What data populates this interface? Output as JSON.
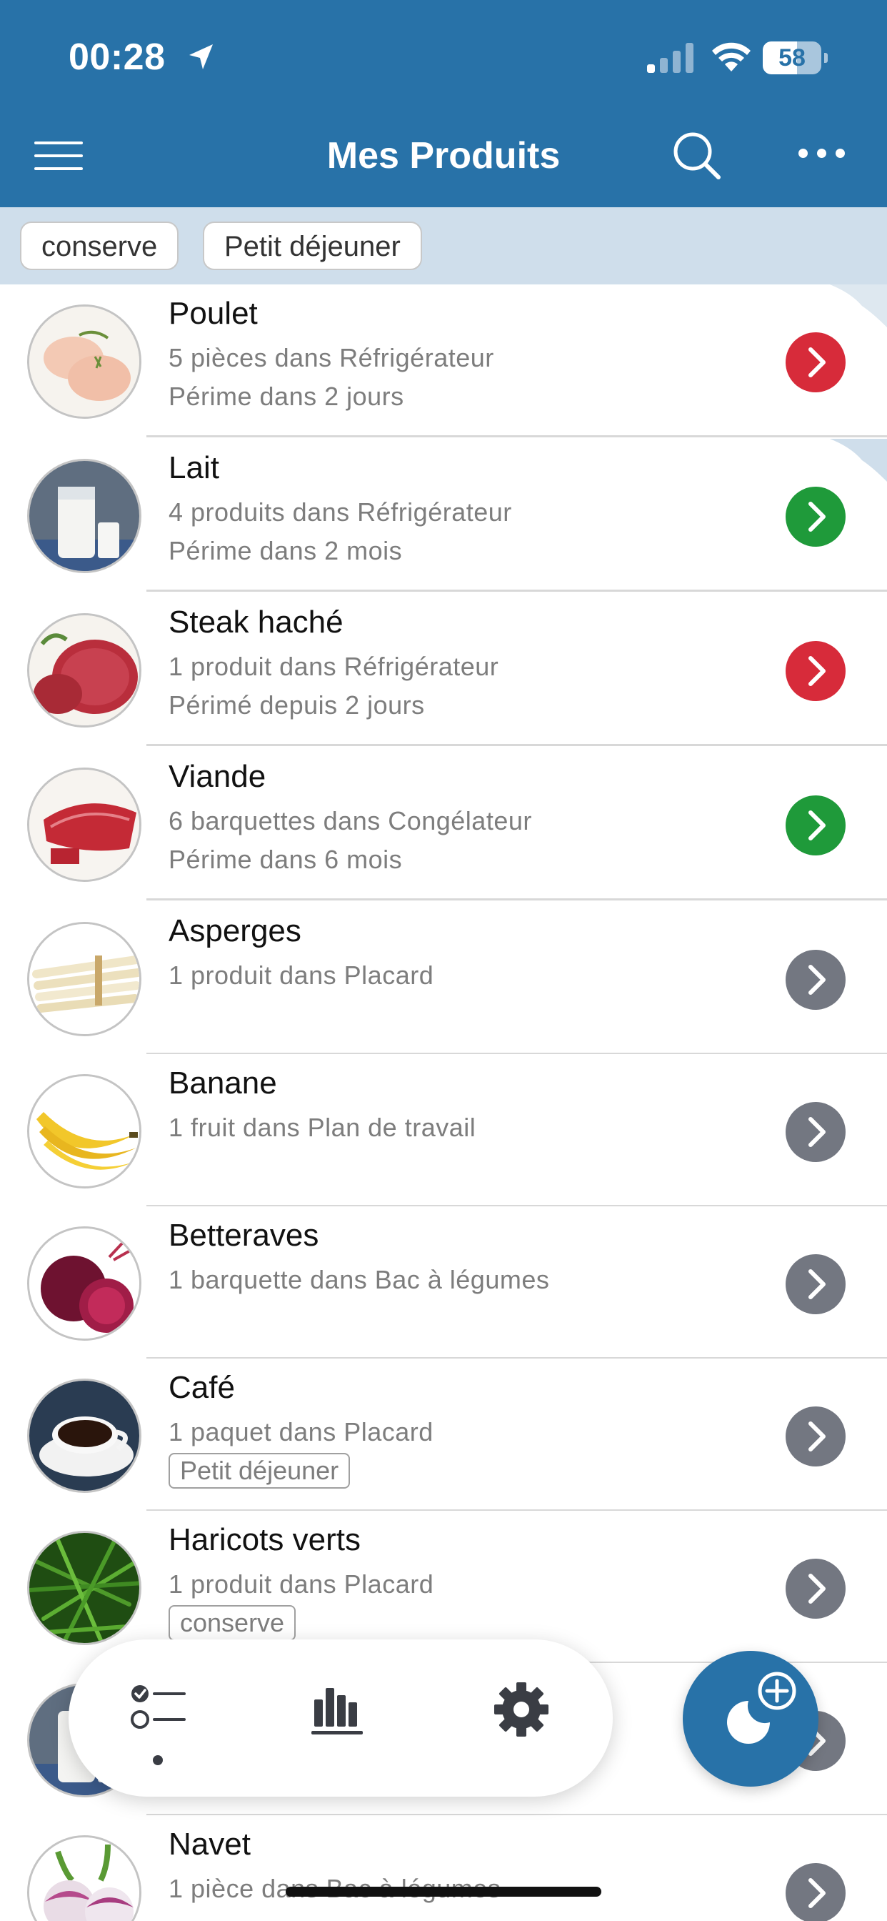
{
  "status_bar": {
    "time": "00:28",
    "battery": "58",
    "battery_level": 0.58
  },
  "header": {
    "title": "Mes Produits"
  },
  "filters": [
    {
      "label": "conserve"
    },
    {
      "label": "Petit déjeuner"
    }
  ],
  "colors": {
    "header_bg": "#2872a8",
    "chip_bar_bg": "#cfdeeb",
    "status_red": "#d72b3a",
    "status_green": "#1f9a3a",
    "status_gray": "#737781"
  },
  "products": [
    {
      "name": "Poulet",
      "line1": "5 pièces dans Réfrigérateur",
      "line2": "Périme dans 2 jours",
      "status": "red",
      "image": "chicken"
    },
    {
      "name": "Lait",
      "line1": "4 produits dans Réfrigérateur",
      "line2": "Périme dans 2 mois",
      "status": "green",
      "image": "milk"
    },
    {
      "name": "Steak haché",
      "line1": "1 produit dans Réfrigérateur",
      "line2": "Périmé depuis 2 jours",
      "status": "red",
      "image": "ground-beef"
    },
    {
      "name": "Viande",
      "line1": "6 barquettes dans Congélateur",
      "line2": "Périme dans 6 mois",
      "status": "green",
      "image": "meat"
    },
    {
      "name": "Asperges",
      "line1": "1 produit dans Placard",
      "line2": "",
      "status": "gray",
      "image": "asparagus"
    },
    {
      "name": "Banane",
      "line1": "1 fruit dans Plan de travail",
      "line2": "",
      "status": "gray",
      "image": "banana"
    },
    {
      "name": "Betteraves",
      "line1": "1 barquette dans Bac à légumes",
      "line2": "",
      "status": "gray",
      "image": "beetroot"
    },
    {
      "name": "Café",
      "line1": "1 paquet dans Placard",
      "tag": "Petit déjeuner",
      "status": "gray",
      "image": "coffee"
    },
    {
      "name": "Haricots verts",
      "line1": "1 produit dans Placard",
      "tag": "conserve",
      "status": "gray",
      "image": "green-beans"
    },
    {
      "name": "",
      "line1": "",
      "line2": "",
      "status": "gray",
      "image": "milk"
    },
    {
      "name": "Navet",
      "line1": "1 pièce dans Bac à légumes",
      "line2": "",
      "status": "gray",
      "image": "turnip"
    }
  ],
  "tabbar": {
    "active": "list"
  }
}
